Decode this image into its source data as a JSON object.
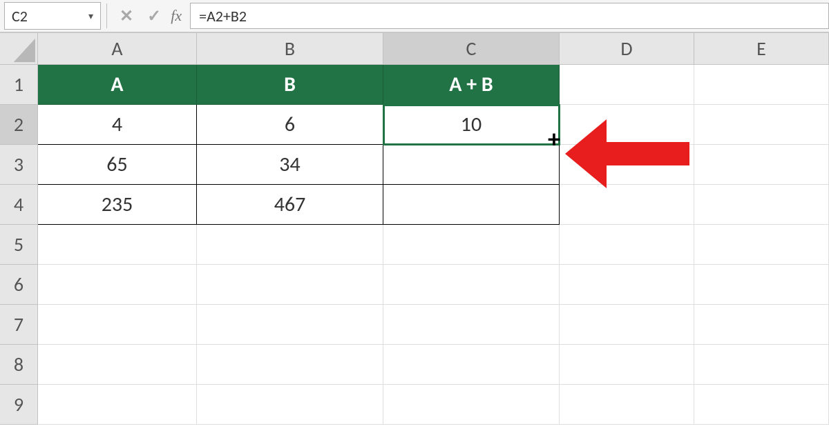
{
  "name_box": "C2",
  "formula": "=A2+B2",
  "fx_label": "fx",
  "columns": [
    "A",
    "B",
    "C",
    "D",
    "E"
  ],
  "rows": [
    "1",
    "2",
    "3",
    "4",
    "5",
    "6",
    "7",
    "8",
    "9"
  ],
  "selected_column_index": 2,
  "selected_row_index": 1,
  "table": {
    "headers": [
      "A",
      "B",
      "A + B"
    ],
    "data": [
      [
        "4",
        "6",
        "10"
      ],
      [
        "65",
        "34",
        ""
      ],
      [
        "235",
        "467",
        ""
      ]
    ]
  },
  "icons": {
    "cancel": "✕",
    "confirm": "✓",
    "dropdown": "▾"
  },
  "arrow_color": "#e81e1e"
}
